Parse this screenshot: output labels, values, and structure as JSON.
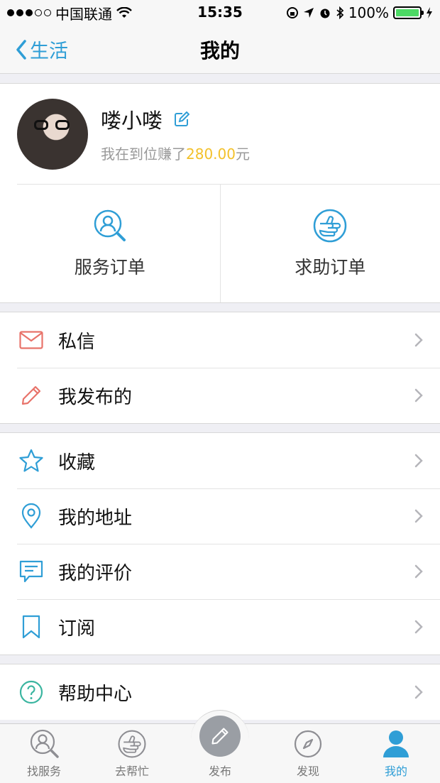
{
  "status_bar": {
    "carrier": "中国联通",
    "time": "15:35",
    "battery": "100%"
  },
  "nav": {
    "back_label": "生活",
    "title": "我的"
  },
  "profile": {
    "name": "喽小喽",
    "earn_prefix": "我在到位赚了",
    "earn_amount": "280.00",
    "earn_suffix": "元"
  },
  "orders": [
    {
      "label": "服务订单",
      "icon": "service-order-icon"
    },
    {
      "label": "求助订单",
      "icon": "help-order-icon"
    }
  ],
  "group1": [
    {
      "label": "私信",
      "icon": "mail-icon",
      "color": "#e8736a"
    },
    {
      "label": "我发布的",
      "icon": "pencil-icon",
      "color": "#e8736a"
    }
  ],
  "group2": [
    {
      "label": "收藏",
      "icon": "star-icon",
      "color": "#2f9ed6"
    },
    {
      "label": "我的地址",
      "icon": "location-pin-icon",
      "color": "#2f9ed6"
    },
    {
      "label": "我的评价",
      "icon": "comment-icon",
      "color": "#2f9ed6"
    },
    {
      "label": "订阅",
      "icon": "bookmark-icon",
      "color": "#2f9ed6"
    }
  ],
  "group3": [
    {
      "label": "帮助中心",
      "icon": "question-icon",
      "color": "#3bb5a0"
    }
  ],
  "tabs": [
    {
      "label": "找服务"
    },
    {
      "label": "去帮忙"
    },
    {
      "label": "发布"
    },
    {
      "label": "发现"
    },
    {
      "label": "我的"
    }
  ]
}
